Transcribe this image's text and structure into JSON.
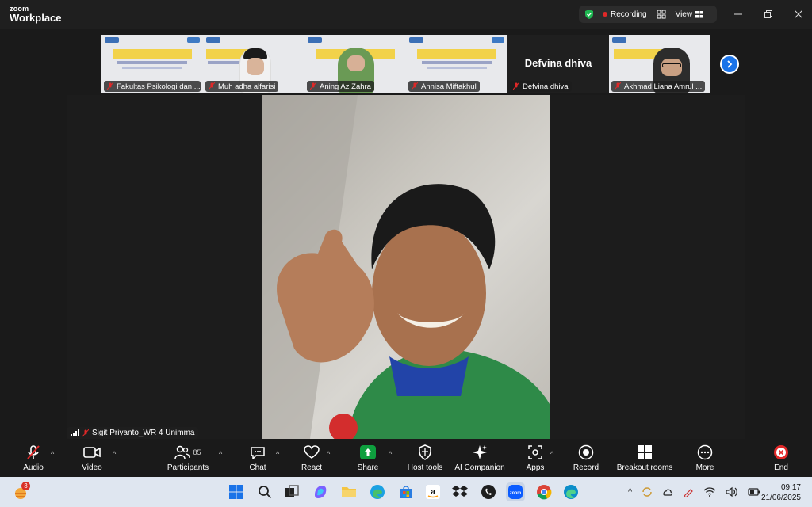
{
  "app": {
    "logo_line1": "zoom",
    "logo_line2": "Workplace"
  },
  "header": {
    "recording_label": "Recording",
    "view_label": "View"
  },
  "strip": {
    "tiles": [
      {
        "name": "Fakultas Psikologi dan ..."
      },
      {
        "name": "Muh adha alfarisi"
      },
      {
        "name": "Aning Az Zahra"
      },
      {
        "name": "Annisa Miftakhul"
      },
      {
        "name": "Defvina dhiva",
        "big_name": "Defvina dhiva"
      },
      {
        "name": "Akhmad Liana Amrul ..."
      }
    ]
  },
  "main": {
    "speaker_name": "Sigit Priyanto_WR 4 Unimma"
  },
  "toolbar": {
    "audio": "Audio",
    "video": "Video",
    "participants": "Participants",
    "participants_count": "85",
    "chat": "Chat",
    "react": "React",
    "share": "Share",
    "host_tools": "Host tools",
    "ai_companion": "AI Companion",
    "apps": "Apps",
    "record": "Record",
    "breakout": "Breakout rooms",
    "more": "More",
    "end": "End"
  },
  "taskbar": {
    "notification_badge": "3",
    "time": "09:17",
    "date": "21/06/2025"
  },
  "colors": {
    "share_green": "#0e9f3e",
    "accent_blue": "#1a73e8",
    "end_red": "#e02828"
  }
}
